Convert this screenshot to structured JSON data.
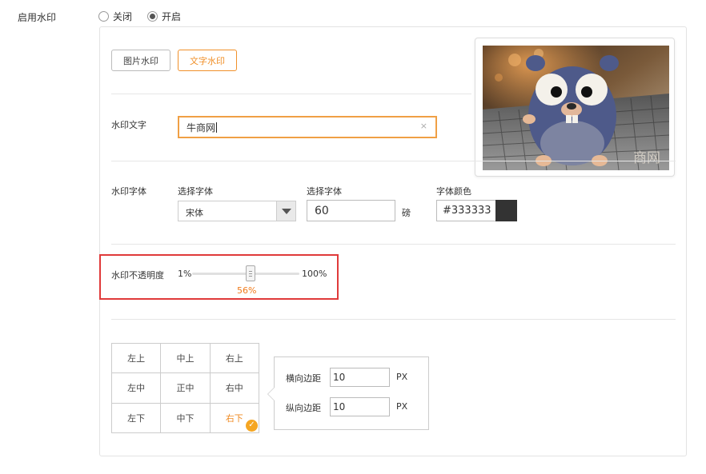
{
  "enable_watermark": {
    "label": "启用水印",
    "options": [
      {
        "label": "关闭",
        "checked": false
      },
      {
        "label": "开启",
        "checked": true
      }
    ]
  },
  "tabs": {
    "image": "图片水印",
    "text": "文字水印",
    "active": "text"
  },
  "text_row": {
    "label": "水印文字",
    "value": "牛商网",
    "clear": "×"
  },
  "font_row": {
    "label": "水印字体",
    "font_select": {
      "title": "选择字体",
      "value": "宋体"
    },
    "size": {
      "title": "选择字体",
      "value": "60",
      "unit": "磅"
    },
    "color": {
      "title": "字体颜色",
      "value": "#333333",
      "swatch": "#333333"
    }
  },
  "opacity_row": {
    "label": "水印不透明度",
    "min": "1%",
    "max": "100%",
    "value": "56%",
    "level": 56
  },
  "position_grid": {
    "cells": [
      "左上",
      "中上",
      "右上",
      "左中",
      "正中",
      "右中",
      "左下",
      "中下",
      "右下"
    ],
    "selected_index": 8,
    "check": "✓"
  },
  "margins": {
    "horizontal": {
      "label": "横向边距",
      "value": "10",
      "unit": "PX"
    },
    "vertical": {
      "label": "纵向边距",
      "value": "10",
      "unit": "PX"
    }
  },
  "preview": {
    "watermark_text": "商网"
  },
  "colors": {
    "accent": "#f0902a",
    "highlight": "#e03a3a"
  }
}
